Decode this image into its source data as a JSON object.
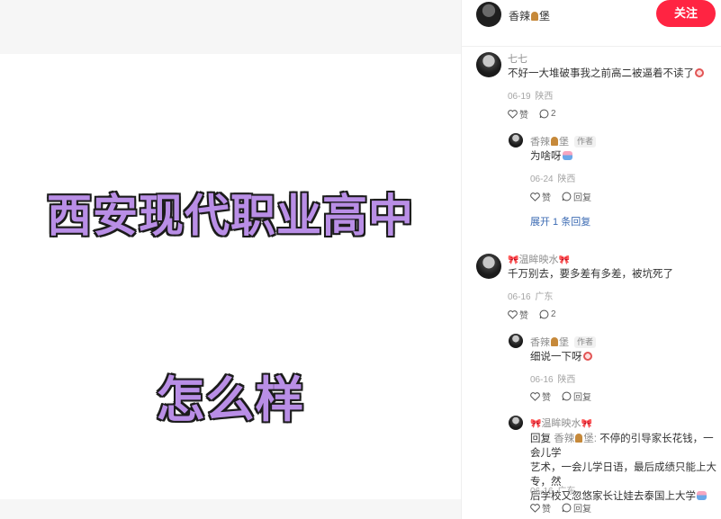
{
  "image": {
    "title_line1": "西安现代职业高中",
    "title_line2": "怎么样"
  },
  "author": {
    "name_a": "香辣",
    "name_b": "堡",
    "follow_label": "关注"
  },
  "labels": {
    "like": "赞",
    "reply": "回复",
    "author_tag": "作者"
  },
  "comments": [
    {
      "user": "七七",
      "text": "不好一大堆破事我之前高二被逼着不读了",
      "date": "06-19",
      "location": "陕西",
      "reply_count": "2",
      "replies": [
        {
          "user_a": "香辣",
          "user_b": "堡",
          "text": "为啥呀",
          "date": "06-24",
          "location": "陕西"
        }
      ],
      "expand_label": "展开 1 条回复"
    },
    {
      "user": "温眸映水",
      "text": "千万别去，要多差有多差，被坑死了",
      "date": "06-16",
      "location": "广东",
      "reply_count": "2",
      "replies": [
        {
          "user_a": "香辣",
          "user_b": "堡",
          "text": "细说一下呀",
          "date": "06-16",
          "location": "陕西"
        },
        {
          "user": "温眸映水",
          "reply_prefix": "回复",
          "target_a": "香辣",
          "target_b": "堡:",
          "text_l1": " 不停的引导家长花钱，一会儿学",
          "text_l2": "艺术，一会儿学日语，最后成绩只能上大专，然",
          "text_l3": "后学校又忽悠家长让娃去泰国上大学",
          "date": "06-16",
          "location": "广东"
        }
      ]
    }
  ]
}
